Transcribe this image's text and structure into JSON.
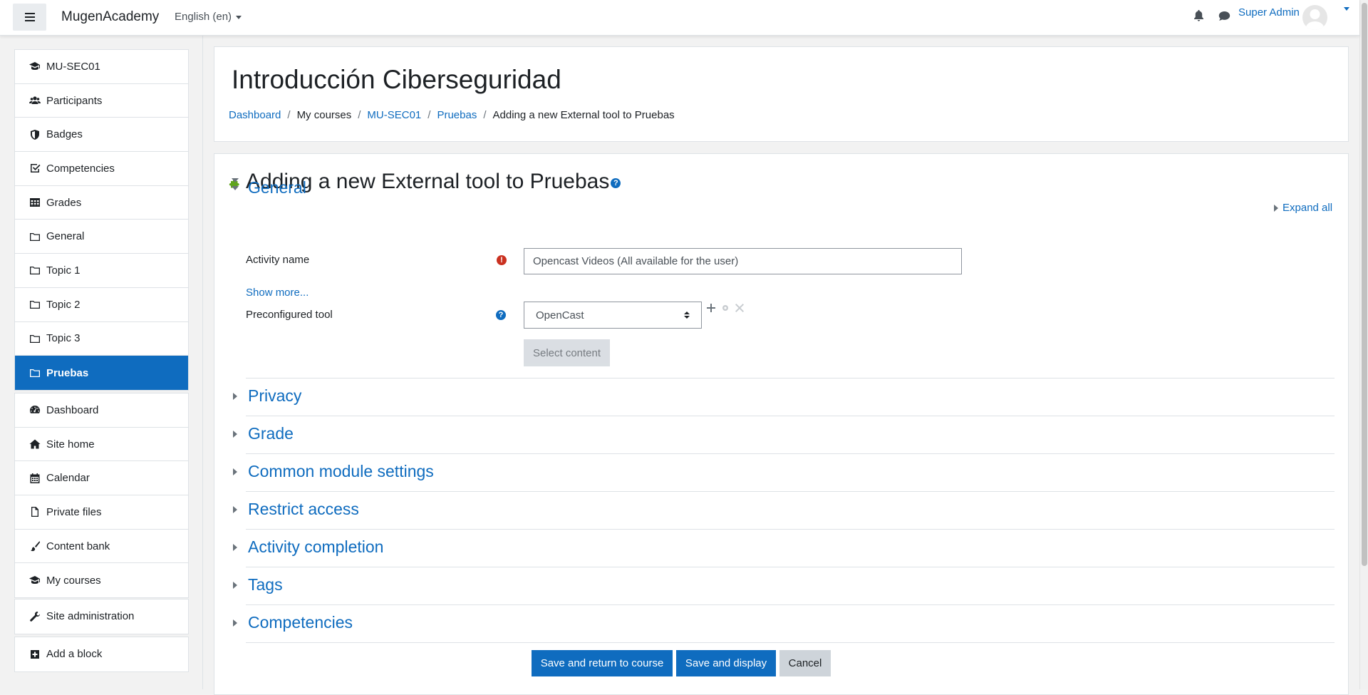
{
  "navbar": {
    "brand": "MugenAcademy",
    "language": "English (en)",
    "user_name": "Super Admin"
  },
  "drawer": {
    "course_nav": [
      {
        "label": "MU-SEC01",
        "icon": "graduation-cap-icon"
      },
      {
        "label": "Participants",
        "icon": "users-icon"
      },
      {
        "label": "Badges",
        "icon": "shield-icon"
      },
      {
        "label": "Competencies",
        "icon": "check-square-icon"
      },
      {
        "label": "Grades",
        "icon": "table-icon"
      },
      {
        "label": "General",
        "icon": "folder-icon"
      },
      {
        "label": "Topic 1",
        "icon": "folder-icon"
      },
      {
        "label": "Topic 2",
        "icon": "folder-icon"
      },
      {
        "label": "Topic 3",
        "icon": "folder-icon"
      },
      {
        "label": "Pruebas",
        "icon": "folder-icon",
        "active": true
      }
    ],
    "site_nav": [
      {
        "label": "Dashboard",
        "icon": "tachometer-icon"
      },
      {
        "label": "Site home",
        "icon": "home-icon"
      },
      {
        "label": "Calendar",
        "icon": "calendar-icon"
      },
      {
        "label": "Private files",
        "icon": "file-icon"
      },
      {
        "label": "Content bank",
        "icon": "paint-brush-icon"
      },
      {
        "label": "My courses",
        "icon": "graduation-cap-icon"
      }
    ],
    "admin_nav": [
      {
        "label": "Site administration",
        "icon": "wrench-icon"
      }
    ],
    "block_nav": [
      {
        "label": "Add a block",
        "icon": "plus-square-icon"
      }
    ]
  },
  "header": {
    "title": "Introducción Ciberseguridad",
    "breadcrumb": [
      {
        "label": "Dashboard",
        "link": true
      },
      {
        "label": "My courses",
        "link": false
      },
      {
        "label": "MU-SEC01",
        "link": true
      },
      {
        "label": "Pruebas",
        "link": true
      },
      {
        "label": "Adding a new External tool to Pruebas",
        "link": false
      }
    ]
  },
  "form": {
    "title": "Adding a new External tool to Pruebas",
    "expand_all": "Expand all",
    "general": {
      "heading": "General",
      "activity_name_label": "Activity name",
      "activity_name_value": "Opencast Videos (All available for the user)",
      "show_more": "Show more...",
      "preconfigured_tool_label": "Preconfigured tool",
      "preconfigured_tool_value": "OpenCast",
      "select_content": "Select content"
    },
    "sections": [
      "Privacy",
      "Grade",
      "Common module settings",
      "Restrict access",
      "Activity completion",
      "Tags",
      "Competencies"
    ],
    "buttons": {
      "save_return": "Save and return to course",
      "save_display": "Save and display",
      "cancel": "Cancel"
    }
  },
  "colors": {
    "primary": "#0f6cbf",
    "required": "#ca3120",
    "plugin_icon": "#5fa41c"
  }
}
